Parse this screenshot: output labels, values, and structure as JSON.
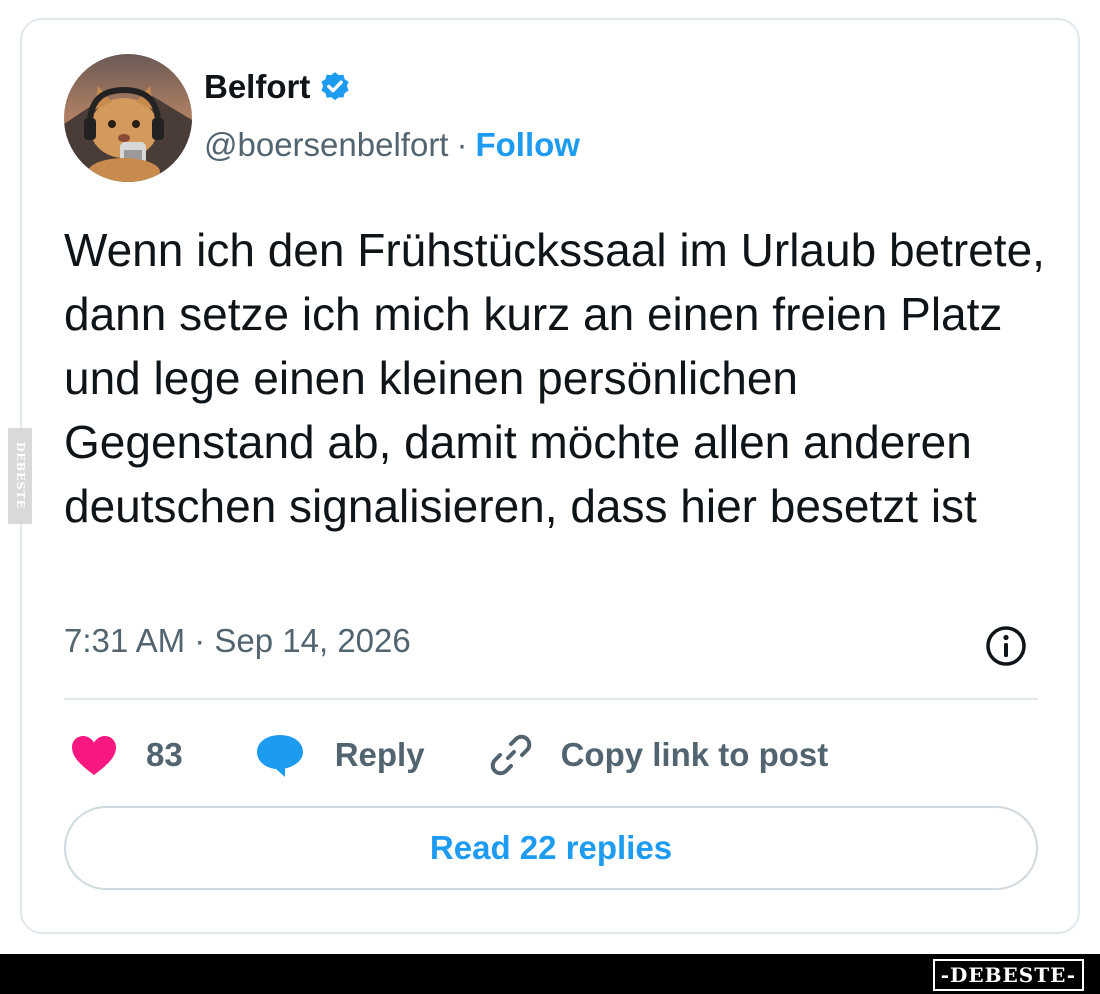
{
  "tweet": {
    "display_name": "Belfort",
    "handle": "@boersenbelfort",
    "separator": "·",
    "follow_label": "Follow",
    "text": "Wenn ich den Frühstückssaal im Urlaub betrete, dann setze ich mich kurz an einen freien Platz und lege einen kleinen persönlichen Gegenstand ab, damit möchte allen anderen deutschen signalisieren, dass hier besetzt ist",
    "timestamp": "7:31 AM · Sep 14, 2026"
  },
  "actions": {
    "like_count": "83",
    "reply_label": "Reply",
    "copy_label": "Copy link to post"
  },
  "read_replies_label": "Read 22 replies",
  "watermark": {
    "side": "DEBESTE",
    "brand": "-DEBESTE-"
  },
  "colors": {
    "accent": "#1d9bf0",
    "heart": "#f91880",
    "muted": "#536471",
    "border": "#e1e8ed"
  },
  "icons": [
    "verified-badge-icon",
    "info-icon",
    "heart-icon",
    "speech-bubble-icon",
    "link-icon"
  ]
}
